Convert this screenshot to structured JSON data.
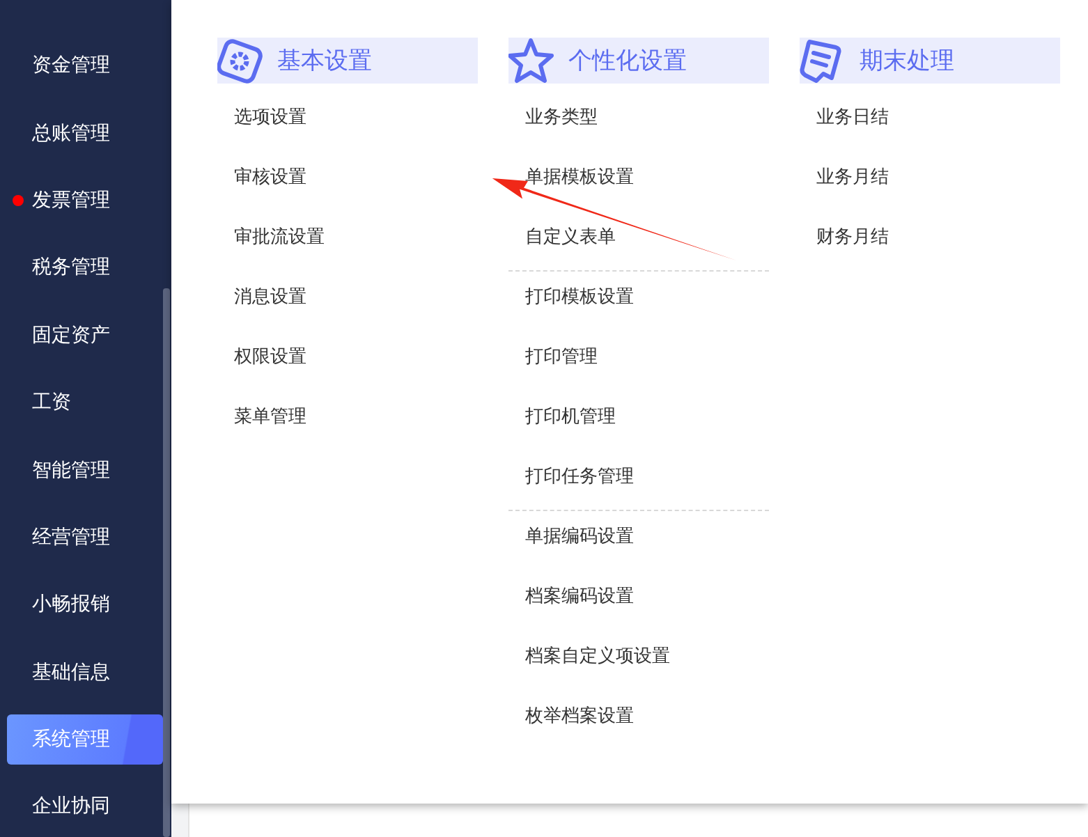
{
  "sidebar": {
    "items": [
      {
        "label": "资金管理",
        "selected": false,
        "alert": false
      },
      {
        "label": "总账管理",
        "selected": false,
        "alert": false
      },
      {
        "label": "发票管理",
        "selected": false,
        "alert": true
      },
      {
        "label": "税务管理",
        "selected": false,
        "alert": false
      },
      {
        "label": "固定资产",
        "selected": false,
        "alert": false
      },
      {
        "label": "工资",
        "selected": false,
        "alert": false
      },
      {
        "label": "智能管理",
        "selected": false,
        "alert": false
      },
      {
        "label": "经营管理",
        "selected": false,
        "alert": false
      },
      {
        "label": "小畅报销",
        "selected": false,
        "alert": false
      },
      {
        "label": "基础信息",
        "selected": false,
        "alert": false
      },
      {
        "label": "系统管理",
        "selected": true,
        "alert": false
      },
      {
        "label": "企业协同",
        "selected": false,
        "alert": false
      }
    ]
  },
  "menu": {
    "columns": [
      {
        "title": "基本设置",
        "groups": [
          [
            "选项设置",
            "审核设置",
            "审批流设置",
            "消息设置",
            "权限设置",
            "菜单管理"
          ]
        ]
      },
      {
        "title": "个性化设置",
        "groups": [
          [
            "业务类型",
            "单据模板设置",
            "自定义表单"
          ],
          [
            "打印模板设置",
            "打印管理",
            "打印机管理",
            "打印任务管理"
          ],
          [
            "单据编码设置",
            "档案编码设置",
            "档案自定义项设置",
            "枚举档案设置"
          ]
        ]
      },
      {
        "title": "期末处理",
        "groups": [
          [
            "业务日结",
            "业务月结",
            "财务月结"
          ]
        ]
      }
    ]
  }
}
